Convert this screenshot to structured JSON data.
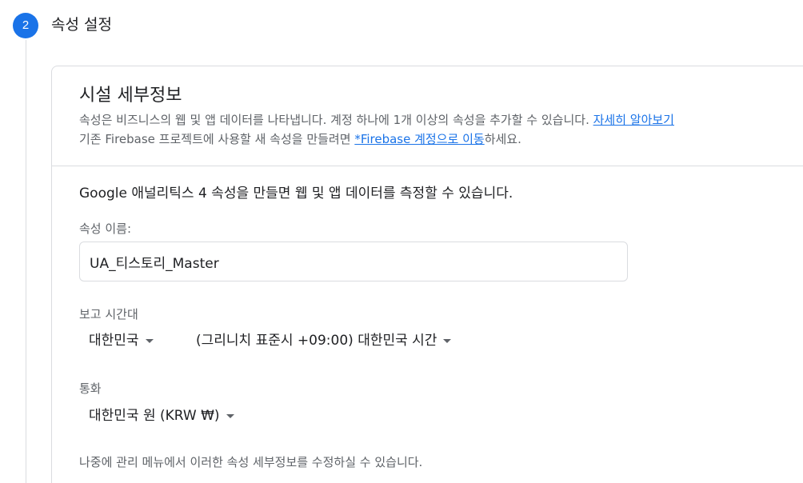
{
  "step": {
    "number": "2",
    "title": "속성 설정"
  },
  "card": {
    "title": "시설 세부정보",
    "desc_line1": "속성은 비즈니스의 웹 및 앱 데이터를 나타냅니다. 계정 하나에 1개 이상의 속성을 추가할 수 있습니다. ",
    "learn_more_link": "자세히 알아보기",
    "desc_line2_prefix": "기존 Firebase 프로젝트에 사용할 새 속성을 만들려면 ",
    "firebase_link": "*Firebase 계정으로 이동",
    "desc_line2_suffix": "하세요."
  },
  "form": {
    "intro": "Google 애널리틱스 4 속성을 만들면 웹 및 앱 데이터를 측정할 수 있습니다.",
    "property_name_label": "속성 이름:",
    "property_name_value": "UA_티스토리_Master",
    "timezone_label": "보고 시간대",
    "country_value": "대한민국",
    "timezone_value": "(그리니치 표준시 +09:00) 대한민국 시간",
    "currency_label": "통화",
    "currency_value": "대한민국 원 (KRW ₩)",
    "footer_note": "나중에 관리 메뉴에서 이러한 속성 세부정보를 수정하실 수 있습니다."
  },
  "colors": {
    "accent": "#1a73e8",
    "text_primary": "#202124",
    "text_secondary": "#5f6368",
    "border": "#dadce0"
  }
}
